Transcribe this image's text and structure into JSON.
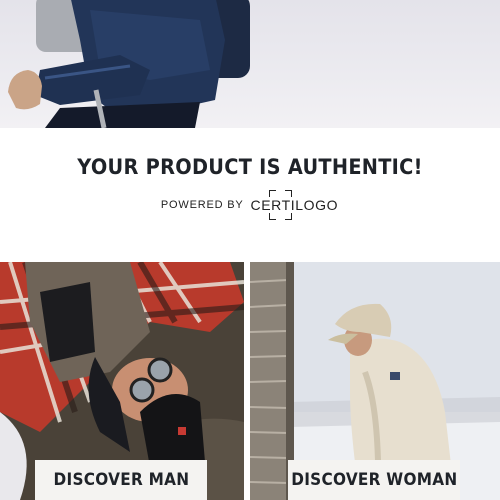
{
  "hero": {
    "image": "winter-hiker-photo"
  },
  "authentication": {
    "title": "YOUR PRODUCT IS AUTHENTIC!",
    "powered_by_label": "POWERED BY",
    "brand_logo_text": "CERTILOGO"
  },
  "categories": [
    {
      "label": "DISCOVER MAN",
      "image": "man-lying-in-snow-photo"
    },
    {
      "label": "DISCOVER WOMAN",
      "image": "woman-in-fleece-photo"
    }
  ],
  "colors": {
    "text": "#1f2329",
    "button_bg": "#f4f3f1",
    "background": "#ffffff"
  }
}
